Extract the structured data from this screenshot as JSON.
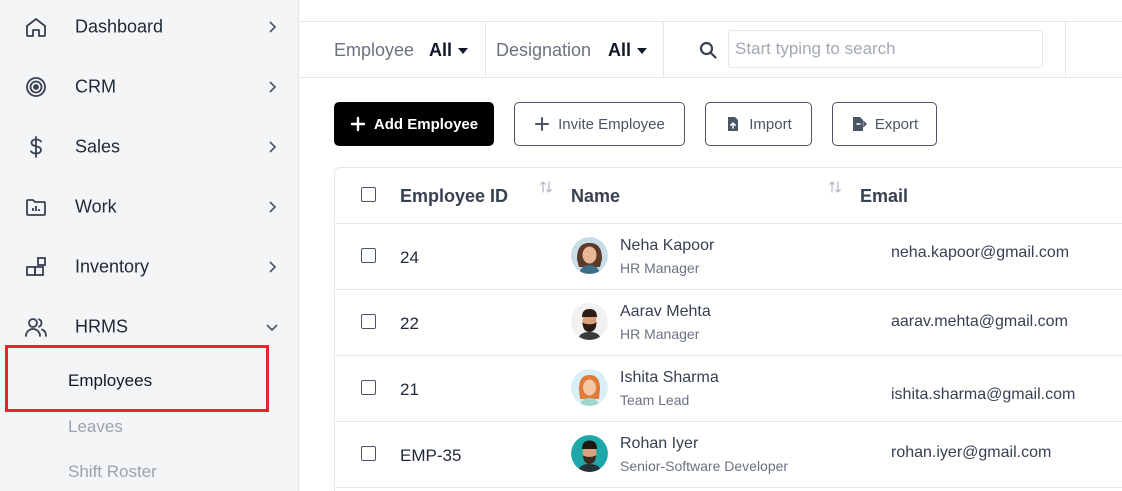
{
  "sidebar": {
    "items": [
      {
        "label": "Dashboard",
        "icon": "home-icon"
      },
      {
        "label": "CRM",
        "icon": "target-icon"
      },
      {
        "label": "Sales",
        "icon": "dollar-icon"
      },
      {
        "label": "Work",
        "icon": "folder-icon"
      },
      {
        "label": "Inventory",
        "icon": "grid-icon"
      },
      {
        "label": "HRMS",
        "icon": "users-icon"
      }
    ],
    "hrms_sub": [
      "Employees",
      "Leaves",
      "Shift Roster"
    ],
    "highlight_color": "#e3262b"
  },
  "filters": {
    "employee_label": "Employee",
    "employee_value": "All",
    "designation_label": "Designation",
    "designation_value": "All",
    "search_placeholder": "Start typing to search"
  },
  "actions": {
    "add": "Add Employee",
    "invite": "Invite Employee",
    "import": "Import",
    "export": "Export"
  },
  "table": {
    "columns": [
      "Employee ID",
      "Name",
      "Email"
    ],
    "rows": [
      {
        "id": "24",
        "name": "Neha Kapoor",
        "role": "HR Manager",
        "email": "neha.kapoor@gmail.com"
      },
      {
        "id": "22",
        "name": "Aarav Mehta",
        "role": "HR Manager",
        "email": "aarav.mehta@gmail.com"
      },
      {
        "id": "21",
        "name": "Ishita Sharma",
        "role": "Team Lead",
        "email": "ishita.sharma@gmail.com"
      },
      {
        "id": "EMP-35",
        "name": "Rohan Iyer",
        "role": "Senior-Software Developer",
        "email": "rohan.iyer@gmail.com"
      }
    ]
  },
  "colors": {
    "primary_button": "#000000",
    "sidebar_bg": "#f4f5f7",
    "border": "#e5e7eb"
  }
}
